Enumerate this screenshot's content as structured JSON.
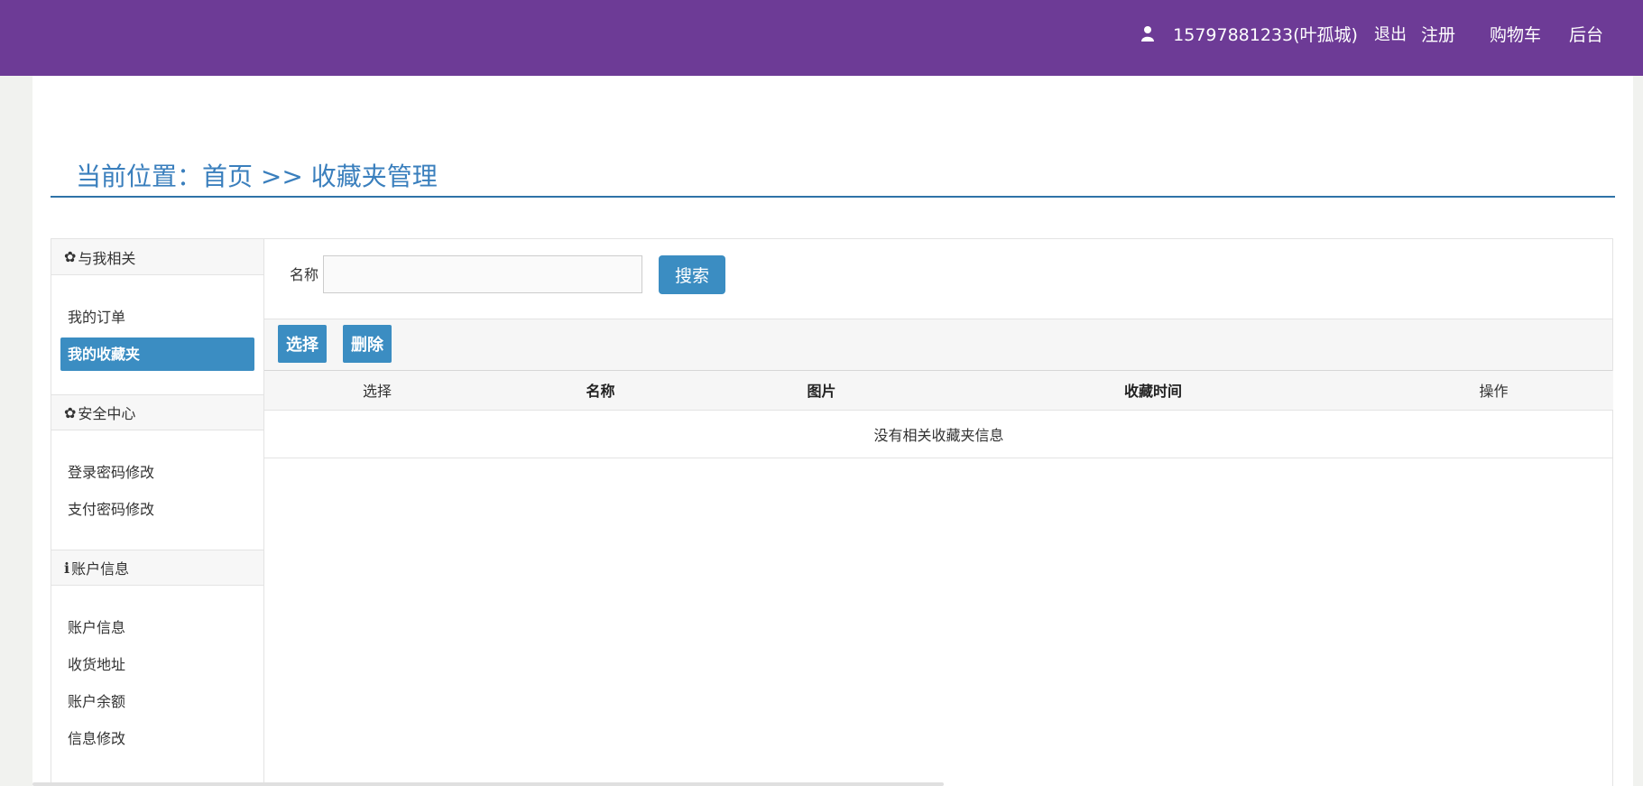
{
  "header": {
    "user_name": "15797881233(叶孤城)",
    "logout": "退出",
    "register": "注册",
    "cart": "购物车",
    "admin": "后台",
    "user_icon": "user-icon",
    "bg_color": "#6d3b96"
  },
  "breadcrumb": {
    "text": "当前位置：首页 >> 收藏夹管理"
  },
  "sidebar": {
    "sections": [
      {
        "title": "与我相关",
        "icon": "gear-icon",
        "items": [
          "我的订单",
          "我的收藏夹"
        ]
      },
      {
        "title": "安全中心",
        "icon": "gear-icon",
        "items": [
          "登录密码修改",
          "支付密码修改"
        ]
      },
      {
        "title": "账户信息",
        "icon": "info-icon",
        "items": [
          "账户信息",
          "收货地址",
          "账户余额",
          "信息修改"
        ]
      }
    ]
  },
  "search": {
    "label": "名称",
    "value": "",
    "button": "搜索"
  },
  "actions": {
    "select": "选择",
    "delete": "删除"
  },
  "table": {
    "columns": [
      "选择",
      "名称",
      "图片",
      "收藏时间",
      "操作"
    ],
    "empty_message": "没有相关收藏夹信息"
  },
  "colors": {
    "accent": "#3b8dc2",
    "breadcrumb": "#3a7fbd"
  }
}
